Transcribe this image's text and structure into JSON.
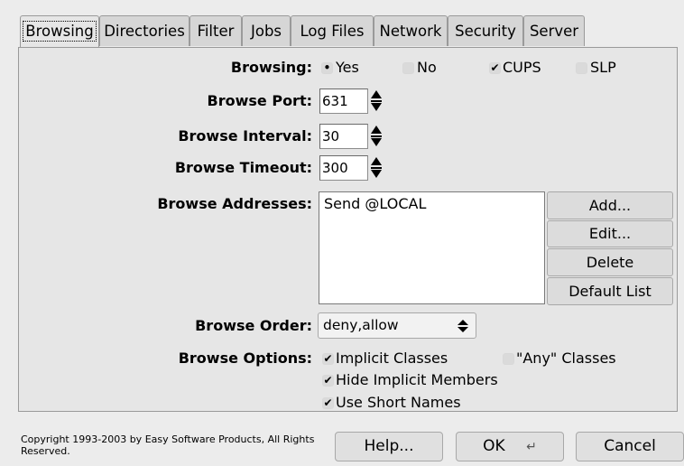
{
  "tabs": [
    "Browsing",
    "Directories",
    "Filter",
    "Jobs",
    "Log Files",
    "Network",
    "Security",
    "Server"
  ],
  "browsing": {
    "label": "Browsing:",
    "yes": "Yes",
    "no": "No",
    "cups": "CUPS",
    "slp": "SLP",
    "yes_selected": true,
    "no_selected": false,
    "cups_checked": true,
    "slp_checked": false
  },
  "browse_port": {
    "label": "Browse Port:",
    "value": "631"
  },
  "browse_interval": {
    "label": "Browse Interval:",
    "value": "30"
  },
  "browse_timeout": {
    "label": "Browse Timeout:",
    "value": "300"
  },
  "browse_addresses": {
    "label": "Browse Addresses:",
    "items": [
      "Send @LOCAL"
    ],
    "buttons": {
      "add": "Add...",
      "edit": "Edit...",
      "delete": "Delete",
      "default": "Default List"
    }
  },
  "browse_order": {
    "label": "Browse Order:",
    "value": "deny,allow"
  },
  "browse_options": {
    "label": "Browse Options:",
    "implicit_classes": "Implicit Classes",
    "any_classes": "\"Any\" Classes",
    "hide_implicit": "Hide Implicit Members",
    "short_names": "Use Short Names",
    "implicit_checked": true,
    "any_checked": false,
    "hide_checked": true,
    "short_checked": true
  },
  "footer": {
    "copyright": "Copyright 1993-2003 by Easy Software Products, All Rights Reserved.",
    "help": "Help...",
    "ok": "OK",
    "cancel": "Cancel"
  },
  "icons": {
    "checkmark": "check-icon",
    "radio": "radio-dot-icon",
    "enter": "enter-key-icon"
  }
}
